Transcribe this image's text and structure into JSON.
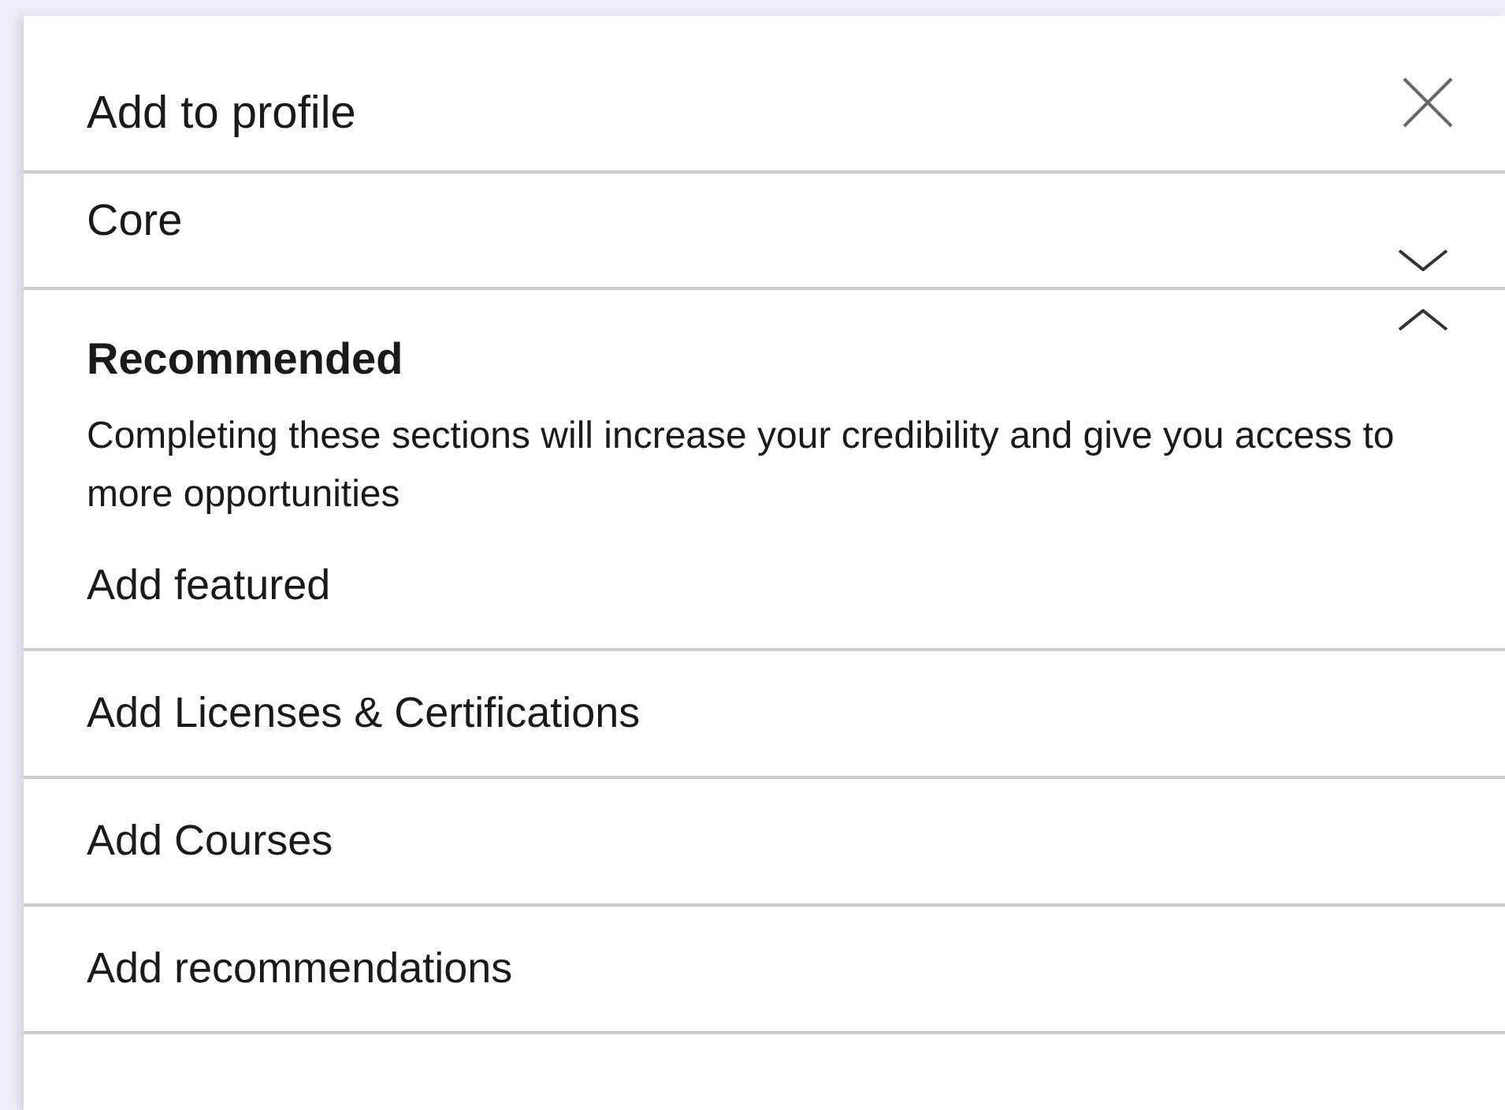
{
  "dialog": {
    "title": "Add to profile"
  },
  "sections": [
    {
      "title": "Core",
      "expanded": false
    },
    {
      "title": "Recommended",
      "expanded": true,
      "description": "Completing these sections will increase your credibility and give you access to more opportunities",
      "items": [
        "Add featured",
        "Add Licenses & Certifications",
        "Add Courses",
        "Add recommendations"
      ]
    }
  ]
}
